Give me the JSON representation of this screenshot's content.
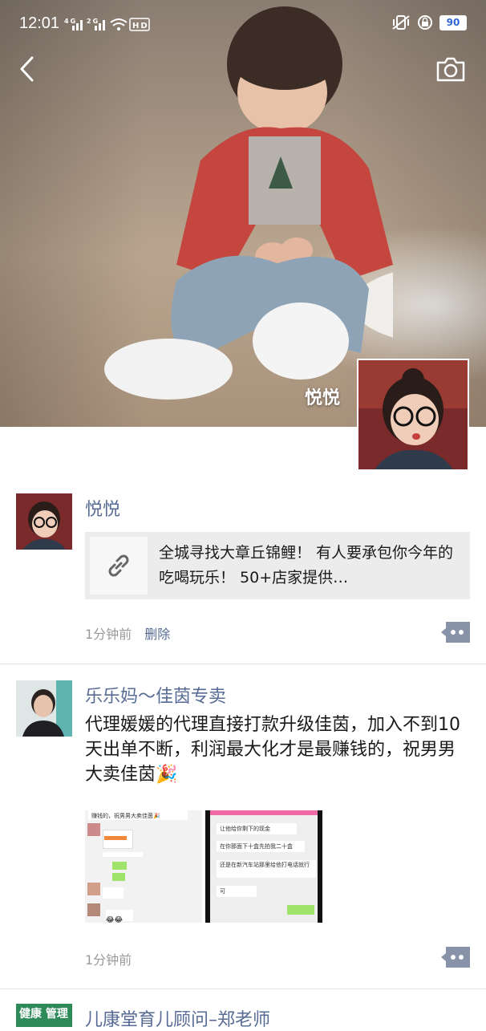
{
  "status_bar": {
    "time": "12:01",
    "network_left": "4G 2G",
    "hd_label": "HD",
    "battery_level": "90"
  },
  "cover": {
    "name": "悦悦"
  },
  "nav": {
    "back_icon": "chevron-left-icon",
    "camera_icon": "camera-icon"
  },
  "posts": [
    {
      "name": "悦悦",
      "link_text": "全城寻找大章丘锦鲤！ 有人要承包你今年的吃喝玩乐！ 50+店家提供…",
      "time": "1分钟前",
      "delete_label": "删除"
    },
    {
      "name": "乐乐妈～佳茵专卖",
      "text": "代理媛媛的代理直接打款升级佳茵，加入不到10天出单不断，利润最大化才是最赚钱的，祝男男大卖佳茵🎉",
      "time": "1分钟前",
      "images": [
        {
          "lines": [
            "赚钱的，祝男男大卖佳茵🎉",
            "",
            "",
            "",
            "",
            "",
            ""
          ]
        },
        {
          "lines": [
            "让他给你剩下的现金",
            "在你那面下十盒先拍我二十盒",
            "还是在新汽车站那里给他打电话就行",
            "可"
          ]
        }
      ]
    },
    {
      "name": "儿康堂育儿顾问–郑老师",
      "avatar_text": "健康 管理"
    }
  ]
}
